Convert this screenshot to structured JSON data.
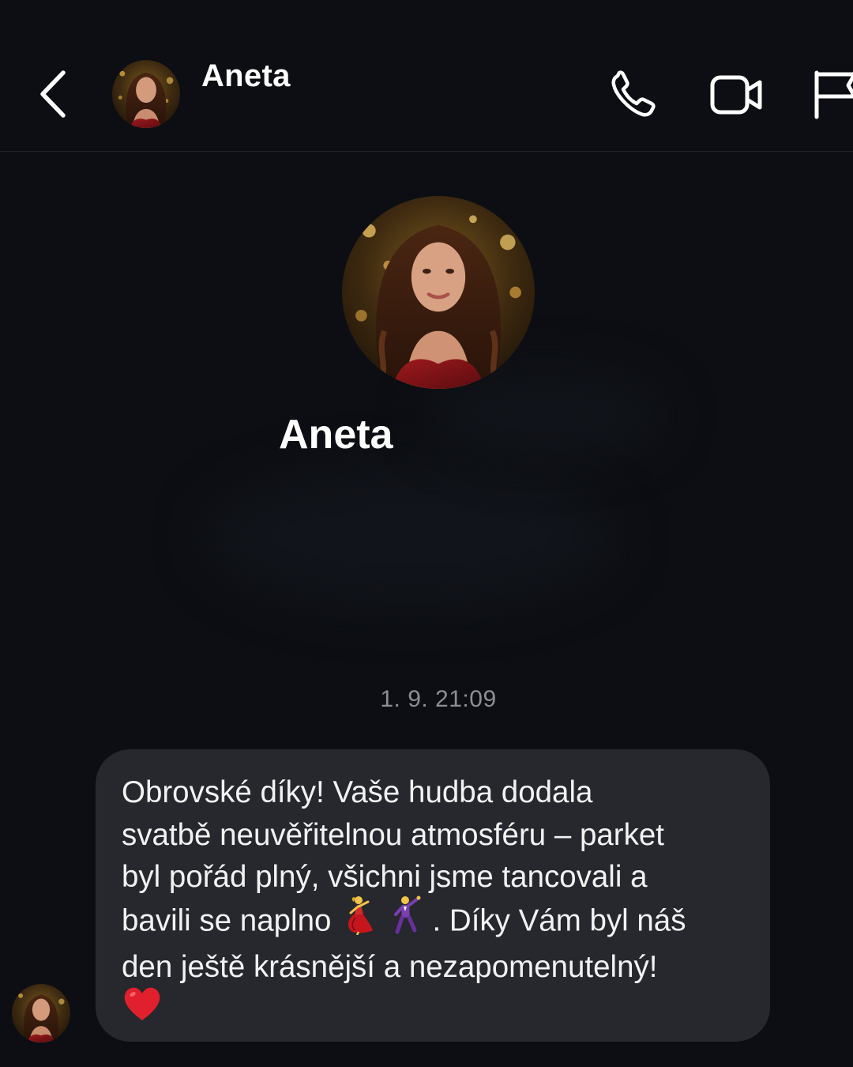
{
  "header": {
    "contact_name": "Aneta",
    "back_icon": "chevron-left-icon",
    "call_icon": "phone-icon",
    "video_icon": "video-camera-icon",
    "flag_icon": "flag-icon"
  },
  "profile": {
    "name": "Aneta"
  },
  "conversation": {
    "timestamp": "1. 9. 21:09",
    "message": {
      "line1": "Obrovské díky! Vaše hudba dodala",
      "line2": "svatbě neuvěřitelnou atmosféru – parket",
      "line3": "byl pořád plný, všichni jsme tancovali a",
      "line4_start": "bavili se naplno",
      "line4_end": ". Díky Vám byl náš",
      "line5": "den ještě krásnější a nezapomenutelný!",
      "emojis": [
        "dancing-woman-icon",
        "dancing-man-icon",
        "red-heart-icon"
      ]
    }
  },
  "colors": {
    "background": "#0c0e13",
    "bubble": "#26282d",
    "timestamp": "#8d8f95",
    "text": "#ffffff"
  }
}
